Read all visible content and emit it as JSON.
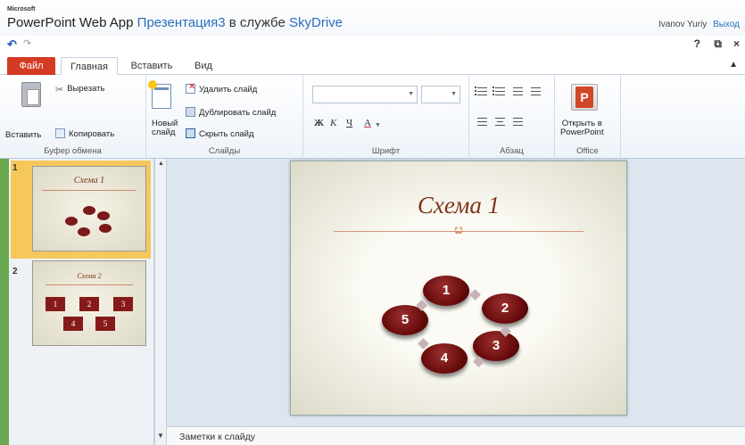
{
  "title_bar": {
    "brand": "Microsoft",
    "app_name": "PowerPoint Web App",
    "doc_name": "Презентация3",
    "service_word": "в службе",
    "service_name": "SkyDrive",
    "user_name": "Ivanov Yuriy",
    "logout": "Выход"
  },
  "qat": {
    "undo": "↶",
    "redo": "↷"
  },
  "window_controls": {
    "help": "?",
    "popout": "⧉",
    "close": "×"
  },
  "tabs": {
    "file": "Файл",
    "home": "Главная",
    "insert": "Вставить",
    "view": "Вид",
    "collapse": "▲"
  },
  "ribbon": {
    "clipboard": {
      "paste": "Вставить",
      "cut": "Вырезать",
      "copy": "Копировать",
      "label": "Буфер обмена"
    },
    "slides": {
      "new_slide_1": "Новый",
      "new_slide_2": "слайд",
      "delete": "Удалить слайд",
      "duplicate": "Дублировать слайд",
      "hide": "Скрыть слайд",
      "label": "Слайды"
    },
    "font": {
      "name": "",
      "size": "",
      "bold": "Ж",
      "italic": "К",
      "underline": "Ч",
      "color": "А",
      "label": "Шрифт"
    },
    "paragraph": {
      "label": "Абзац"
    },
    "office": {
      "open_1": "Открыть в",
      "open_2": "PowerPoint",
      "label": "Office"
    }
  },
  "thumbnails": [
    {
      "number": "1",
      "title": "Схема 1"
    },
    {
      "number": "2",
      "title": "Схема 2",
      "boxes": [
        "1",
        "2",
        "3",
        "4",
        "5"
      ]
    }
  ],
  "slide": {
    "title": "Схема 1",
    "ornament": "ೞ",
    "circles": [
      "1",
      "2",
      "3",
      "4",
      "5"
    ]
  },
  "notes": {
    "label": "Заметки к слайду"
  },
  "colors": {
    "file_tab": "#d33b25",
    "accent_blue": "#2a6ebb",
    "circle": "#6a0c0c",
    "title": "#7d3518"
  }
}
